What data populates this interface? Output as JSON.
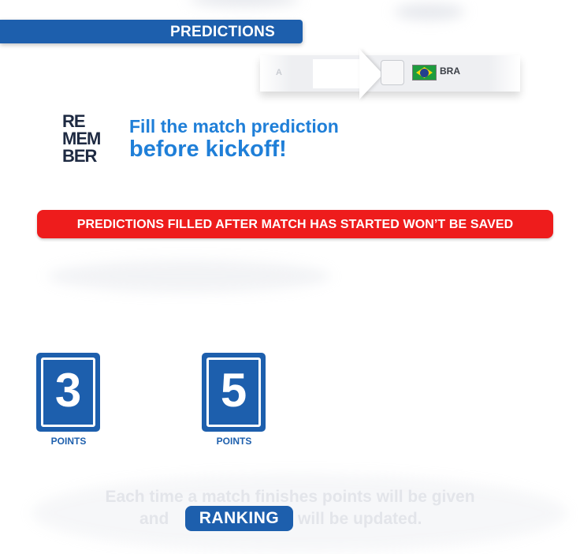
{
  "header": {
    "title": "PREDICTIONS"
  },
  "match": {
    "faded_team_code": "A",
    "team_code": "BRA",
    "team_flag_icon": "brazil-flag-icon"
  },
  "reminder": {
    "remember_lines": [
      "RE",
      "MEM",
      "BER"
    ],
    "line1": "Fill the match prediction",
    "line2": "before kickoff!"
  },
  "warning": {
    "text": "PREDICTIONS FILLED AFTER MATCH HAS STARTED WON’T BE SAVED"
  },
  "points": [
    {
      "value": "3",
      "label": "POINTS"
    },
    {
      "value": "5",
      "label": "POINTS"
    }
  ],
  "footer": {
    "line1": "Each time a match finishes points will be given",
    "line2_left": "and",
    "line2_right": "will be updated.",
    "ranking_label": "RANKING"
  },
  "colors": {
    "brand_blue": "#1d5fad",
    "accent_blue": "#1f7fd8",
    "warning_red": "#ee1c1c",
    "dark_navy": "#1e2a42"
  }
}
